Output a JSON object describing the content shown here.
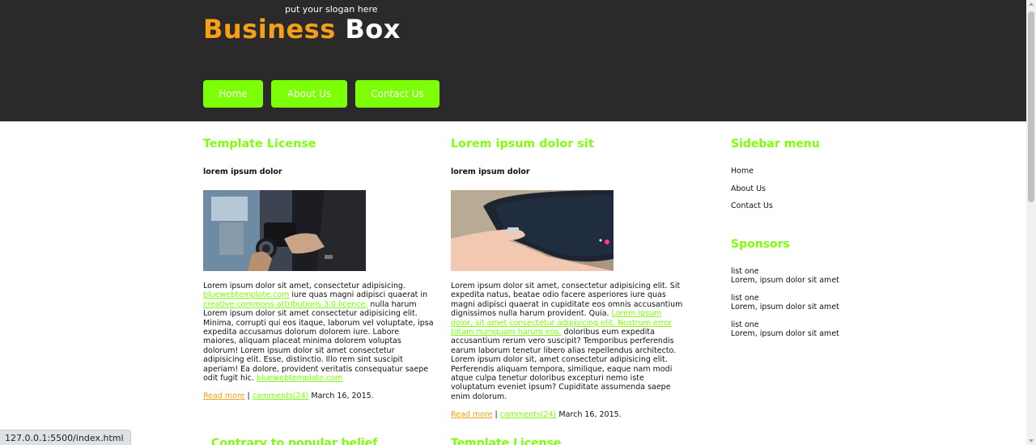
{
  "header": {
    "slogan": "put your slogan here",
    "logo_part1": "Business",
    "logo_part2": "Box",
    "colors": {
      "background": "#2b2929",
      "accent_orange": "#f5a016",
      "accent_green": "#7dff08"
    }
  },
  "nav": {
    "items": [
      {
        "label": "Home"
      },
      {
        "label": "About Us"
      },
      {
        "label": "Contact Us"
      }
    ]
  },
  "posts": [
    {
      "title": "Template License",
      "subtitle": "lorem ipsum dolor",
      "image": "person-holding-camera-photo",
      "text1": "Lorem ipsum dolor sit amet, consectetur adipisicing.",
      "link1": "bluewebtemplate.com",
      "text2": " iure quas magni adipisci quaerat in ",
      "link2": "creative commons attributions 3.0 licence.",
      "text3": " nulla harum Lorem ipsum dolor sit amet consectetur adipisicing elit. Minima, corrupti qui eos itaque, laborum vel voluptate, ipsa expedita accusamus dolorum dolorem iure. Labore maiores, aliquam placeat minima dolorem voluptas dolorum! Lorem ipsum dolor sit amet consectetur adipisicing elit. Esse, distinctio. Illo rem sint suscipit aperiam! Ea dolore, provident veritatis consequatur saepe odit fugit hic. ",
      "link3": "bluewebtemplate.com",
      "read_more": "Read more",
      "separator": "|",
      "comments": "comments(24)",
      "date": "March 16, 2015."
    },
    {
      "title": "Lorem ipsum dolor sit",
      "subtitle": "lorem ipsum dolor",
      "image": "hand-holding-tablet-photo",
      "text1": "Lorem ipsum dolor sit amet, consectetur adipisicing elit. Sit expedita natus, beatae odio facere asperiores iure quas magni adipisci quaerat in cupiditate eos omnis accusantium dignissimos nulla harum provident. Quia. ",
      "link1": "Lorem ipsum dolor, sit amet consectetur adipisicing elit. Nostrum error totam numquam harum eos.",
      "text2": " doloribus eum expedita accusantium rerum vero suscipit? Temporibus perferendis earum laborum tenetur libero alias repellendus architecto. Lorem ipsum dolor sit, amet consectetur adipisicing elit. Perferendis aliquam tempora, similique, eaque nam modi atque culpa tenetur doloribus excepturi nemo iste voluptatum eveniet ipsum? Cupiditate assumenda saepe enim dolorum.",
      "read_more": "Read more",
      "separator": "|",
      "comments": "comments(24)",
      "date": "March 16, 2015."
    }
  ],
  "sidebar": {
    "menu_title": "Sidebar menu",
    "menu_items": [
      {
        "label": "Home"
      },
      {
        "label": "About Us"
      },
      {
        "label": "Contact Us"
      }
    ],
    "sponsors_title": "Sponsors",
    "sponsors": [
      {
        "name": "list one",
        "desc": "Lorem, ipsum dolor sit amet"
      },
      {
        "name": "list one",
        "desc": "Lorem, ipsum dolor sit amet"
      },
      {
        "name": "list one",
        "desc": "Lorem, ipsum dolor sit amet"
      }
    ]
  },
  "bottom": {
    "left_title": "Contrary to popular belief",
    "middle_title": "Template License"
  },
  "status_bar": {
    "url": "127.0.0.1:5500/index.html"
  }
}
